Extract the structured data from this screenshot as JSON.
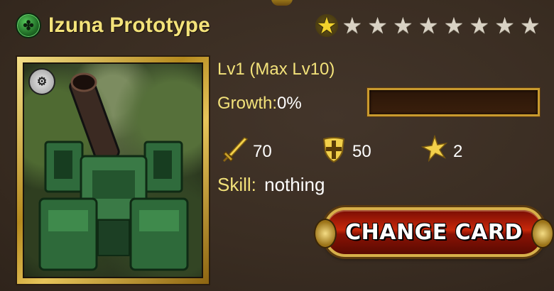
{
  "card": {
    "name": "Izuna Prototype",
    "type_icon": "mech-type-icon",
    "rarity_filled": 1,
    "rarity_total": 9
  },
  "info": {
    "level_text": "Lv1 (Max Lv10)",
    "growth_label": "Growth:",
    "growth_value": "0%",
    "growth_fraction": 0.0
  },
  "stats": {
    "attack": "70",
    "defense": "50",
    "cost": "2"
  },
  "skill": {
    "label": "Skill:",
    "value": "nothing"
  },
  "actions": {
    "change_card_label": "CHANGE CARD"
  },
  "colors": {
    "accent_yellow": "#f3e27a",
    "background": "#3a2d22",
    "button_red": "#c8280a",
    "gold_frame": "#b58a1e"
  }
}
